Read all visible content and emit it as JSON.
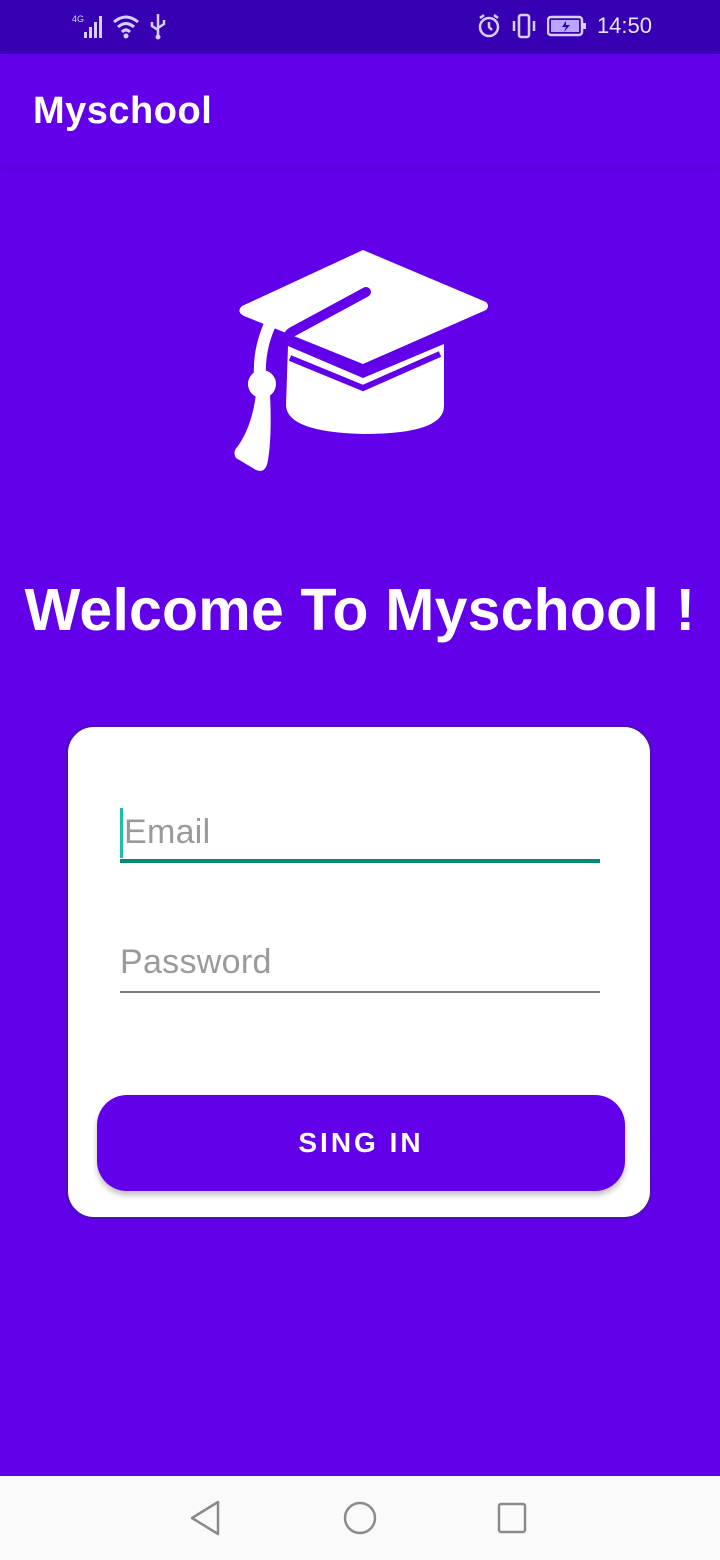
{
  "status_bar": {
    "network": "4G",
    "time": "14:50",
    "icons": [
      "signal-icon",
      "wifi-icon",
      "usb-icon",
      "alarm-icon",
      "vibrate-icon",
      "battery-icon"
    ]
  },
  "app_bar": {
    "title": "Myschool"
  },
  "main": {
    "logo_icon": "graduation-cap-icon",
    "welcome_text": "Welcome To Myschool !"
  },
  "login_form": {
    "email": {
      "placeholder": "Email",
      "value": ""
    },
    "password": {
      "placeholder": "Password",
      "value": ""
    },
    "submit_label": "SING IN"
  },
  "nav_bar": {
    "icons": [
      "back-icon",
      "home-icon",
      "recents-icon"
    ]
  },
  "colors": {
    "primary": "#6200EA",
    "primary_dark": "#3700B3",
    "focus_underline": "#0B8A72",
    "card": "#FFFFFF"
  }
}
